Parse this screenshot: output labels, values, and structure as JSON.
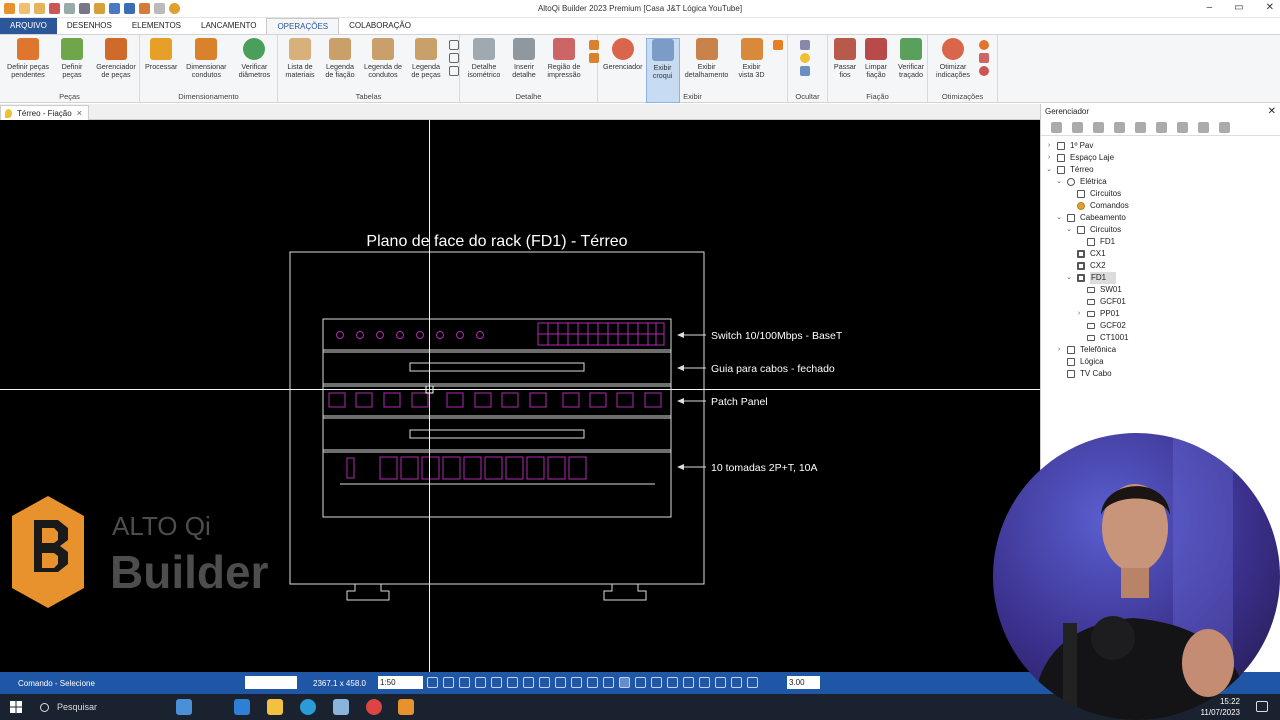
{
  "window": {
    "title": "AltoQi Builder 2023 Premium [Casa J&T Lógica YouTube]",
    "controls": [
      "–",
      "▭",
      "✕"
    ]
  },
  "tabs": [
    {
      "label": "ARQUIVO"
    },
    {
      "label": "DESENHOS"
    },
    {
      "label": "ELEMENTOS"
    },
    {
      "label": "LANCAMENTO"
    },
    {
      "label": "OPERAÇÕES"
    },
    {
      "label": "COLABORAÇÃO"
    }
  ],
  "ribbon": {
    "groups": [
      {
        "label": "Peças",
        "buttons": [
          "Definir peças pendentes",
          "Definir peças",
          "Gerenciador de peças"
        ]
      },
      {
        "label": "Dimensionamento",
        "buttons": [
          "Processar",
          "Dimensionar condutos",
          "Verificar diâmetros"
        ]
      },
      {
        "label": "Tabelas",
        "buttons": [
          "Lista de materiais",
          "Legenda de fiação",
          "Legenda de condutos",
          "Legenda de peças"
        ]
      },
      {
        "label": "Detalhe",
        "buttons": [
          "Detalhe isométrico",
          "Inserir detalhe",
          "Região de impressão"
        ]
      },
      {
        "label": "Exibir",
        "buttons": [
          "Gerenciador",
          "Exibir croqui",
          "Exibir detalhamento",
          "Exibir vista 3D"
        ]
      },
      {
        "label": "Ocultar",
        "buttons": []
      },
      {
        "label": "Fiação",
        "buttons": [
          "Passar fios",
          "Limpar fiação",
          "Verificar traçado"
        ]
      },
      {
        "label": "Otimizações",
        "buttons": [
          "Otimizar indicações"
        ]
      }
    ]
  },
  "document_tab": {
    "label": "Térreo - Fiação",
    "close": "×"
  },
  "drawing": {
    "title": "Plano de face do rack (FD1) - Térreo",
    "labels": [
      "Switch 10/100Mbps - BaseT",
      "Guia para cabos - fechado",
      "Patch Panel",
      "10 tomadas 2P+T, 10A"
    ]
  },
  "watermark": {
    "brand": "ALTO Qi",
    "product": "Builder"
  },
  "panel": {
    "title": "Gerenciador",
    "close": "✕",
    "tree": [
      {
        "label": "1º Pav"
      },
      {
        "label": "Espaço Laje"
      },
      {
        "label": "Térreo"
      },
      {
        "label": "Elétrica"
      },
      {
        "label": "Circuitos"
      },
      {
        "label": "Comandos"
      },
      {
        "label": "Cabeamento"
      },
      {
        "label": "Circuitos"
      },
      {
        "label": "FD1"
      },
      {
        "label": "CX1"
      },
      {
        "label": "CX2"
      },
      {
        "label": "FD1"
      },
      {
        "label": "SW01"
      },
      {
        "label": "GCF01"
      },
      {
        "label": "PP01"
      },
      {
        "label": "GCF02"
      },
      {
        "label": "CT1001"
      },
      {
        "label": "Telefônica"
      },
      {
        "label": "Lógica"
      },
      {
        "label": "TV Cabo"
      }
    ]
  },
  "statusbar": {
    "command": "Comando - Selecione",
    "coords": "2367.1 x 458.0",
    "scale": "1:50",
    "step": "3.00"
  },
  "taskbar": {
    "search": "Pesquisar",
    "time": "15:22",
    "date": "11/07/2023"
  },
  "colors": {
    "accent": "#2b579a",
    "statusbar": "#1f56a6",
    "cad_background": "#000000",
    "cad_magenta": "#b12bb1",
    "logo_orange": "#e8922e"
  }
}
